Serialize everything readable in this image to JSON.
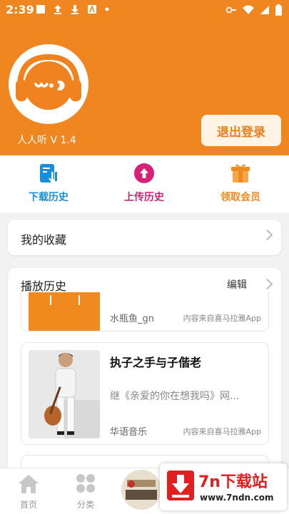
{
  "status_bar": {
    "time": "2:39"
  },
  "header": {
    "app_version": "人人听 V 1.4",
    "logout_label": "退出登录",
    "accent_color": "#f0861f"
  },
  "quick_actions": [
    {
      "label": "下载历史",
      "color": "#1a8fd8",
      "icon": "download-history-icon"
    },
    {
      "label": "上传历史",
      "color": "#d8207a",
      "icon": "upload-cloud-icon"
    },
    {
      "label": "领取会员",
      "color": "#f08a1e",
      "icon": "gift-box-icon"
    }
  ],
  "favorites": {
    "label": "我的收藏"
  },
  "history": {
    "title": "播放历史",
    "edit_label": "编辑",
    "items": [
      {
        "category": "水瓶鱼_gn",
        "source": "内容来自喜马拉雅App"
      },
      {
        "title": "执子之手与子偕老",
        "description": "继《亲爱的你在想我吗》网...",
        "category": "华语音乐",
        "source": "内容来自喜马拉雅App"
      }
    ]
  },
  "bottom_nav": [
    {
      "label": "首页",
      "icon": "home-icon"
    },
    {
      "label": "分类",
      "icon": "category-grid-icon"
    }
  ],
  "promo": {
    "brand": "7n下载站",
    "url": "www.7ndn.com"
  }
}
